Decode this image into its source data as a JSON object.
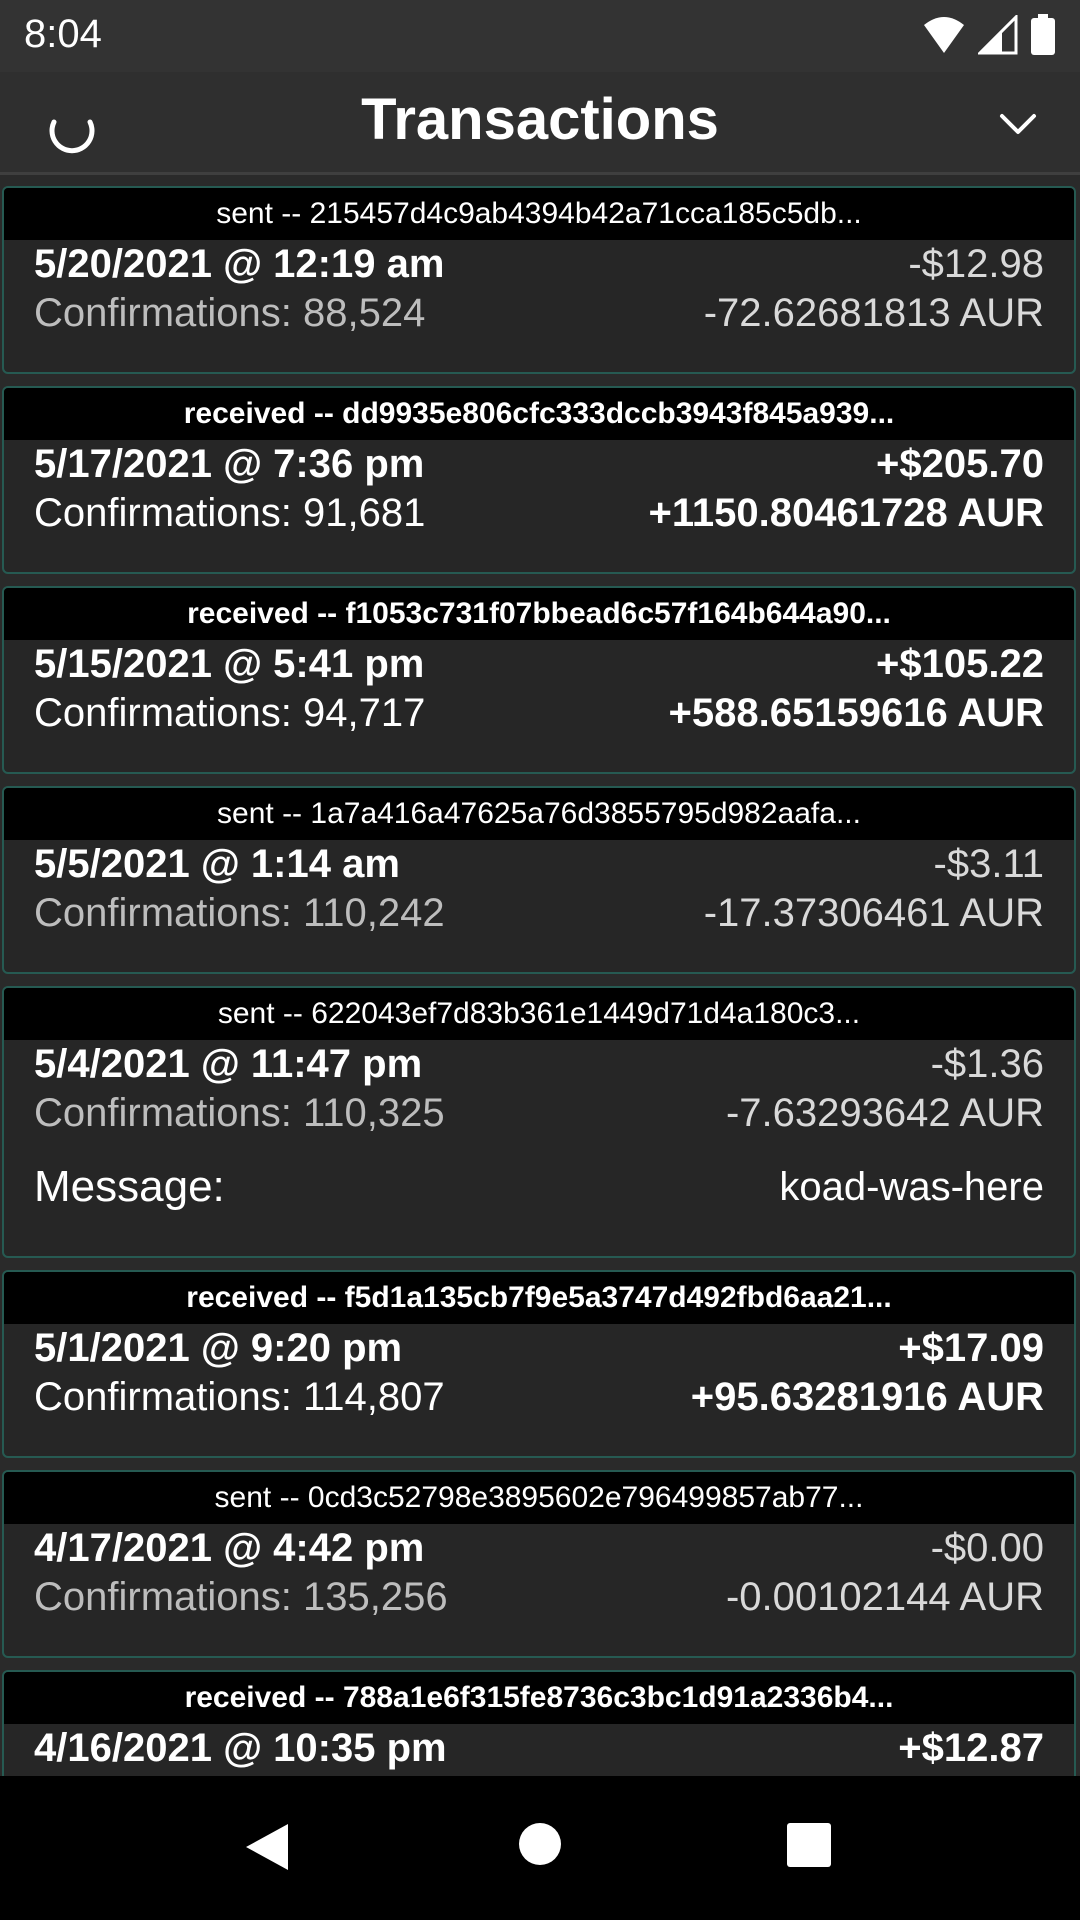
{
  "status_bar": {
    "time": "8:04"
  },
  "app_bar": {
    "title": "Transactions"
  },
  "transactions": [
    {
      "type": "sent",
      "header": "sent -- 215457d4c9ab4394b42a71cca185c5db...",
      "date": "5/20/2021 @ 12:19 am",
      "confirmations": "Confirmations: 88,524",
      "usd": "-$12.98",
      "aur": "-72.62681813 AUR"
    },
    {
      "type": "received",
      "header": "received -- dd9935e806cfc333dccb3943f845a939...",
      "date": "5/17/2021 @ 7:36 pm",
      "confirmations": "Confirmations: 91,681",
      "usd": "+$205.70",
      "aur": "+1150.80461728 AUR"
    },
    {
      "type": "received",
      "header": "received -- f1053c731f07bbead6c57f164b644a90...",
      "date": "5/15/2021 @ 5:41 pm",
      "confirmations": "Confirmations: 94,717",
      "usd": "+$105.22",
      "aur": "+588.65159616 AUR"
    },
    {
      "type": "sent",
      "header": "sent -- 1a7a416a47625a76d3855795d982aafa...",
      "date": "5/5/2021 @ 1:14 am",
      "confirmations": "Confirmations: 110,242",
      "usd": "-$3.11",
      "aur": "-17.37306461 AUR"
    },
    {
      "type": "sent",
      "header": "sent -- 622043ef7d83b361e1449d71d4a180c3...",
      "date": "5/4/2021 @ 11:47 pm",
      "confirmations": "Confirmations: 110,325",
      "usd": "-$1.36",
      "aur": "-7.63293642 AUR",
      "message_label": "Message:",
      "message": "koad-was-here"
    },
    {
      "type": "received",
      "header": "received -- f5d1a135cb7f9e5a3747d492fbd6aa21...",
      "date": "5/1/2021 @ 9:20 pm",
      "confirmations": "Confirmations: 114,807",
      "usd": "+$17.09",
      "aur": "+95.63281916 AUR"
    },
    {
      "type": "sent",
      "header": "sent -- 0cd3c52798e3895602e796499857ab77...",
      "date": "4/17/2021 @ 4:42 pm",
      "confirmations": "Confirmations: 135,256",
      "usd": "-$0.00",
      "aur": "-0.00102144 AUR"
    },
    {
      "type": "received",
      "header": "received -- 788a1e6f315fe8736c3bc1d91a2336b4...",
      "date": "4/16/2021 @ 10:35 pm",
      "confirmations": "",
      "usd": "+$12.87",
      "aur": ""
    }
  ],
  "icons": {
    "refresh": "refresh-icon",
    "dropdown": "chevron-down-icon",
    "wifi": "wifi-icon",
    "signal": "signal-icon",
    "battery": "battery-icon",
    "back": "back-icon",
    "home": "home-icon",
    "recents": "recents-icon"
  },
  "colors": {
    "card_border": "#265a52",
    "header_bg": "#000000",
    "card_bg": "#262626"
  }
}
